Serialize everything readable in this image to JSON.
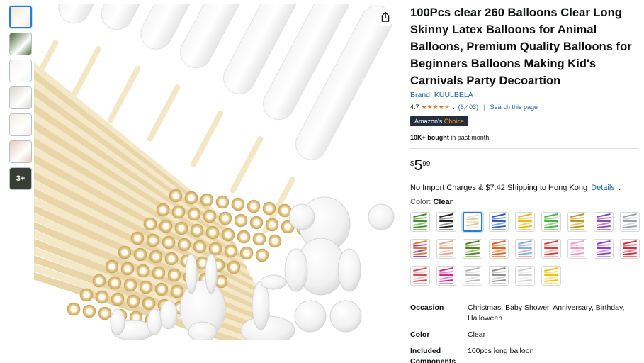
{
  "thumbnails": [
    {
      "name": "thumb-1",
      "color": "#f1e5c8",
      "active": true
    },
    {
      "name": "thumb-2",
      "color": "#4a6b3a",
      "active": false
    },
    {
      "name": "thumb-3",
      "color": "#f3f3f3",
      "active": false
    },
    {
      "name": "thumb-4",
      "color": "#d9d6cf",
      "active": false
    },
    {
      "name": "thumb-5",
      "color": "#f4e9e2",
      "active": false
    },
    {
      "name": "thumb-6",
      "color": "#e8c9c0",
      "active": false
    }
  ],
  "more_thumbs_label": "3+",
  "share_icon": "share-icon",
  "product": {
    "title": "100Pcs clear 260 Balloons Clear Long Skinny Latex Balloons for Animal Balloons, Premium Quality Balloons for Beginners Balloons Making Kid's Carnivals Party Decoartion",
    "brand": "Brand: KUULBELA",
    "rating": "4.7",
    "rating_stars": 4.5,
    "review_count": "(6,403)",
    "search_link": "Search this page",
    "badge_prefix": "Amazon's",
    "badge_suffix": "Choice",
    "bought_bold": "10K+ bought",
    "bought_rest": "in past month",
    "price_symbol": "$",
    "price_whole": "5",
    "price_fraction": "99",
    "shipping_text": "No Import Charges & $7.42 Shipping to Hong Kong",
    "shipping_details": "Details",
    "color_label": "Color:",
    "color_value": "Clear"
  },
  "swatches": [
    [
      "#3f8f3a",
      "#8fbf62"
    ],
    [
      "#222222",
      "#999999"
    ],
    [
      "#f2e6c9",
      "#d8c9a3"
    ],
    [
      "#3657c4",
      "#7ea4e8"
    ],
    [
      "#f0b323",
      "#f7d36b"
    ],
    [
      "#41b34a",
      "#9fd27a"
    ],
    [
      "#b8922a",
      "#e0c46a"
    ],
    [
      "#7a4fbf",
      "#e07aa0"
    ],
    [
      "#9aa0a6",
      "#d5d9d9"
    ],
    [
      "#e8742a",
      "#8c4fc2"
    ],
    [
      "#e9a58c",
      "#f6d3c4"
    ],
    [
      "#4f7f2f",
      "#9dbf5f"
    ],
    [
      "#e85c2c",
      "#f39a4e"
    ],
    [
      "#6db8e8",
      "#f4a5c0"
    ],
    [
      "#d93c3c",
      "#f3b4b4"
    ],
    [
      "#f29ac0",
      "#fbd1e2"
    ],
    [
      "#8a3fd1",
      "#c799f0"
    ],
    [
      "#d9263a",
      "#f07380"
    ],
    [
      "#d94a4a",
      "#f2c0c0"
    ],
    [
      "#d9279a",
      "#f08ac6"
    ],
    [
      "#b5b5b5",
      "#e2e2e2"
    ],
    [
      "#8d8d8d",
      "#cfcfcf"
    ],
    [
      "#cfcfcf",
      "#f0f0f0"
    ],
    [
      "#f2c200",
      "#f9e27a"
    ]
  ],
  "details": [
    {
      "key": "Occasion",
      "value": "Christmas, Baby Shower, Anniversary, Birthday, Halloween"
    },
    {
      "key": "Color",
      "value": "Clear"
    },
    {
      "key": "Included Components",
      "value": "100pcs long balloon"
    }
  ]
}
